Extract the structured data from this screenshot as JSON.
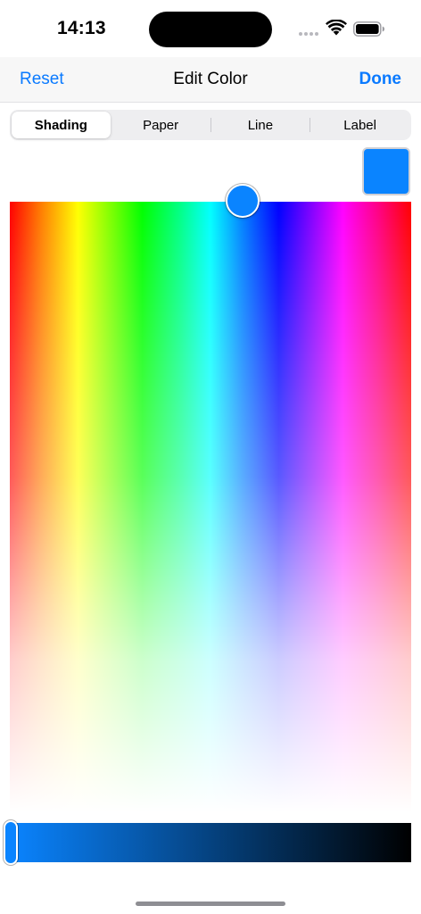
{
  "status_bar": {
    "time": "14:13"
  },
  "nav": {
    "reset_label": "Reset",
    "title": "Edit Color",
    "done_label": "Done"
  },
  "segments": [
    {
      "label": "Shading",
      "selected": true
    },
    {
      "label": "Paper",
      "selected": false
    },
    {
      "label": "Line",
      "selected": false
    },
    {
      "label": "Label",
      "selected": false
    }
  ],
  "colors": {
    "accent": "#0a7aff",
    "selected_color": "#0a84ff"
  },
  "icons": {
    "signal": "cellular-signal-icon",
    "wifi": "wifi-icon",
    "battery": "battery-icon"
  }
}
